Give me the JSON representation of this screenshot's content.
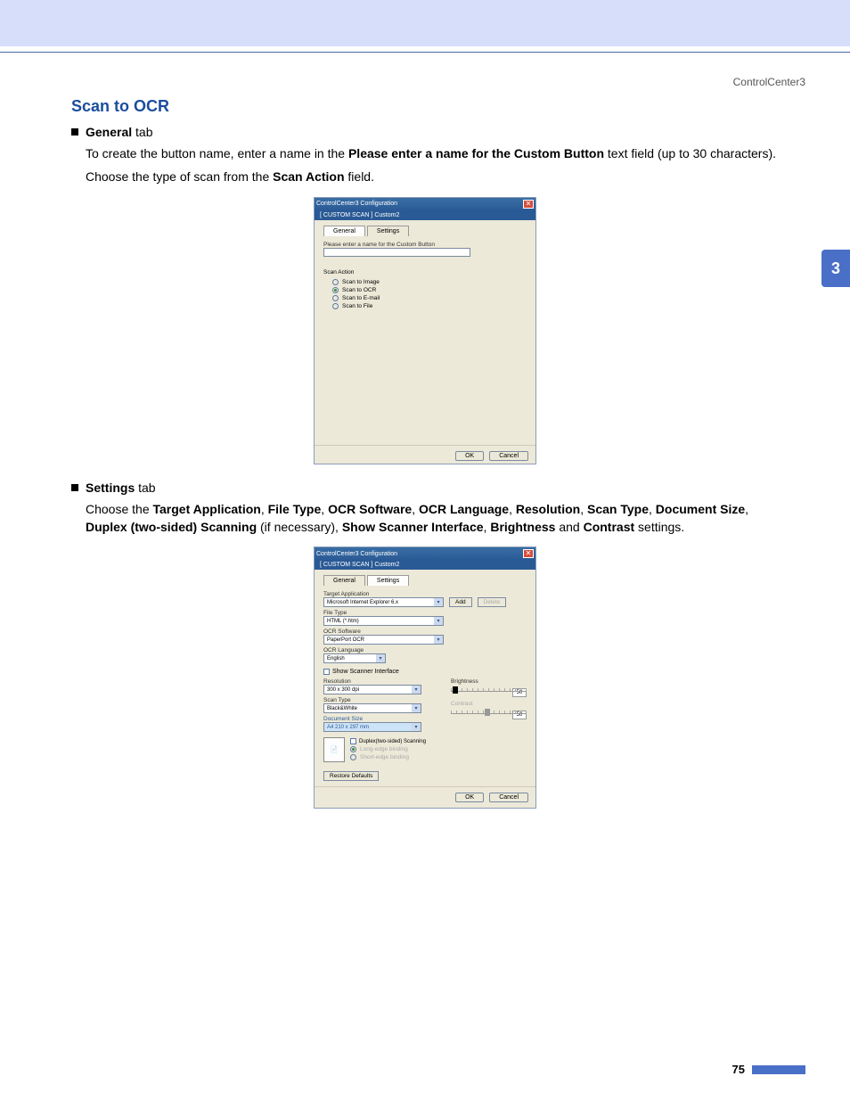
{
  "header": {
    "chapter_ref": "ControlCenter3"
  },
  "side_tab": "3",
  "section": {
    "title": "Scan to OCR",
    "general": {
      "bullet_label_bold": "General",
      "bullet_label_rest": " tab",
      "p1_a": "To create the button name, enter a name in the ",
      "p1_b": "Please enter a name for the Custom Button",
      "p1_c": " text field (up to 30 characters).",
      "p2_a": "Choose the type of scan from the ",
      "p2_b": "Scan Action",
      "p2_c": " field."
    },
    "settings": {
      "bullet_label_bold": "Settings",
      "bullet_label_rest": " tab",
      "p1_a": "Choose the ",
      "k1": "Target Application",
      "c1": ", ",
      "k2": "File Type",
      "c2": ", ",
      "k3": "OCR Software",
      "c3": ", ",
      "k4": "OCR Language",
      "c4": ", ",
      "k5": "Resolution",
      "c5": ", ",
      "k6": "Scan Type",
      "c6": ", ",
      "k7": "Document Size",
      "c7": ", ",
      "k8": "Duplex  (two-sided) Scanning",
      "c8": " (if necessary), ",
      "k9": "Show Scanner Interface",
      "c9": ", ",
      "k10": "Brightness",
      "p1_b": " and ",
      "k11": "Contrast",
      "p1_c": " settings."
    }
  },
  "dialog1": {
    "title": "ControlCenter3 Configuration",
    "subtitle": "[  CUSTOM SCAN  ]   Custom2",
    "tabs": {
      "general": "General",
      "settings": "Settings"
    },
    "name_label": "Please enter a name for the Custom Button",
    "name_value": "",
    "group": "Scan Action",
    "radios": {
      "image": "Scan to Image",
      "ocr": "Scan to OCR",
      "email": "Scan to E-mail",
      "file": "Scan to File"
    },
    "ok": "OK",
    "cancel": "Cancel"
  },
  "dialog2": {
    "title": "ControlCenter3 Configuration",
    "subtitle": "[  CUSTOM SCAN  ]   Custom2",
    "tabs": {
      "general": "General",
      "settings": "Settings"
    },
    "target_label": "Target Application",
    "target_value": "Microsoft Internet Explorer 6.x",
    "add": "Add",
    "delete": "Delete",
    "filetype_label": "File Type",
    "filetype_value": "HTML (*.htm)",
    "ocrsoft_label": "OCR Software",
    "ocrsoft_value": "PaperPort OCR",
    "ocrlang_label": "OCR Language",
    "ocrlang_value": "English",
    "show_scanner": "Show Scanner Interface",
    "resolution_label": "Resolution",
    "resolution_value": "300 x 300 dpi",
    "scantype_label": "Scan Type",
    "scantype_value": "Black&White",
    "docsize_label": "Document Size",
    "docsize_value": "A4 210 x 297 mm",
    "brightness_label": "Brightness",
    "brightness_value": "50",
    "contrast_label": "Contrast",
    "contrast_value": "50",
    "duplex_cb": "Duplex(two-sided) Scanning",
    "duplex_long": "Long-edge binding",
    "duplex_short": "Short-edge binding",
    "restore": "Restore Defaults",
    "ok": "OK",
    "cancel": "Cancel"
  },
  "page_number": "75"
}
